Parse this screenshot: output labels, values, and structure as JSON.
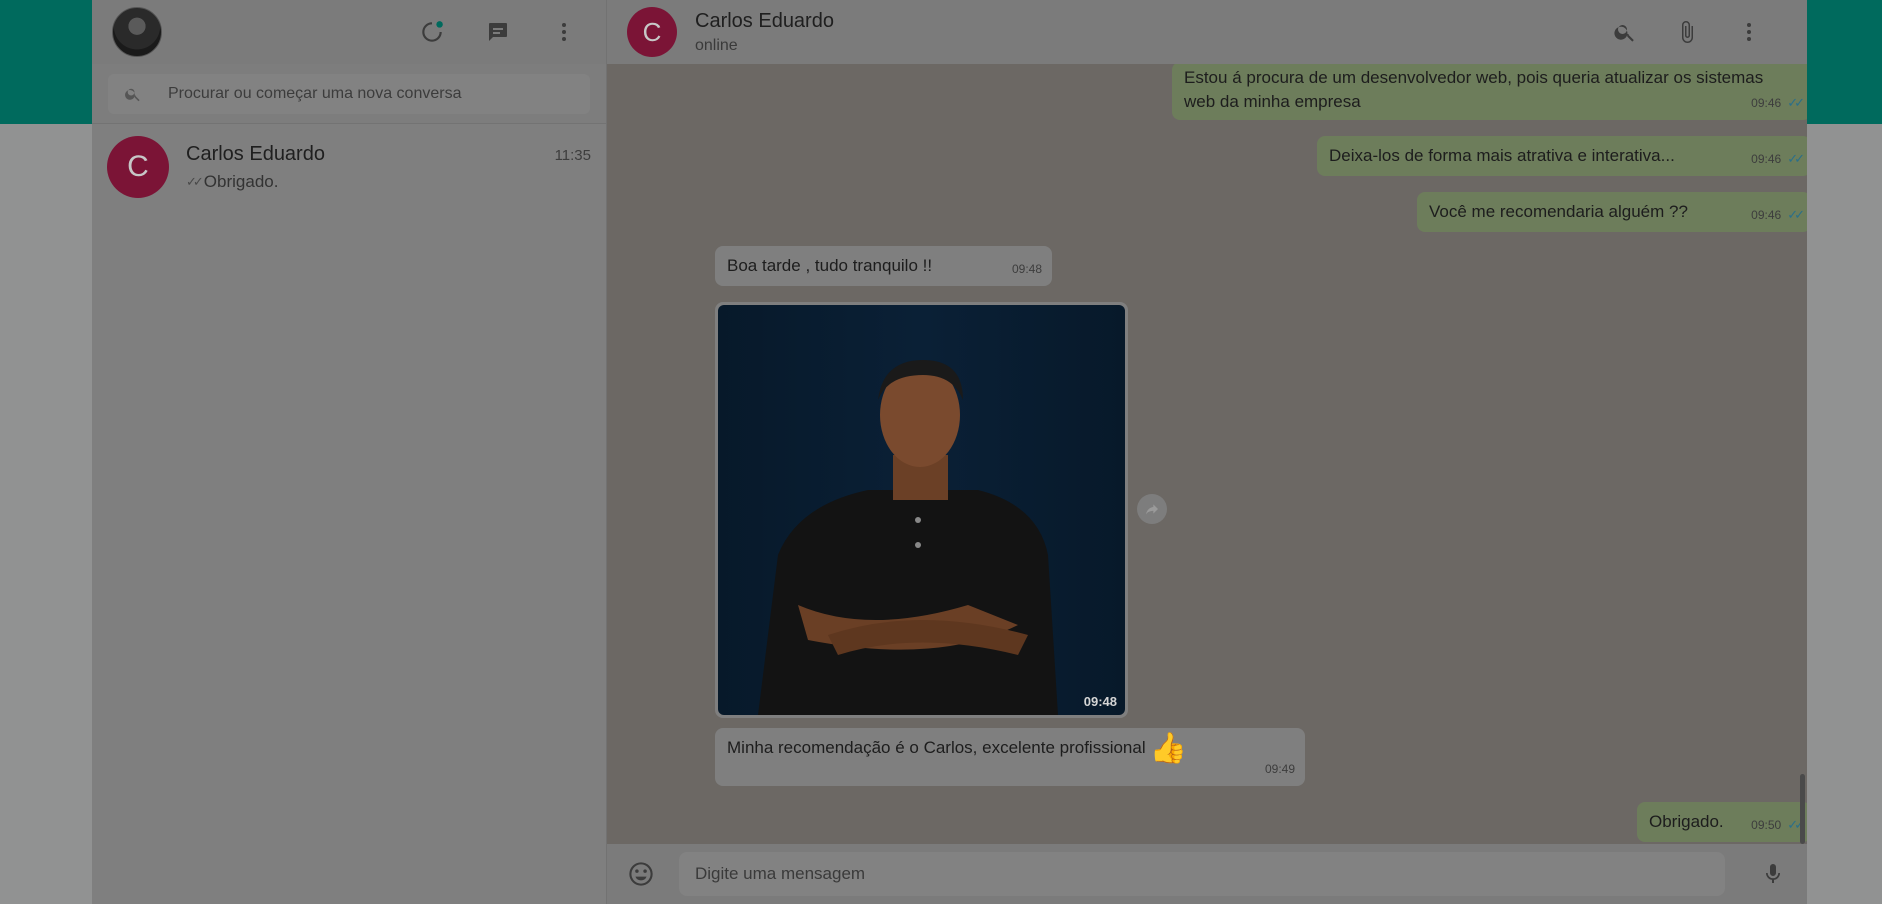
{
  "sidebar": {
    "icons": {
      "status": "status-icon",
      "new_chat": "new-chat-icon",
      "menu": "menu-dots-icon"
    },
    "search": {
      "placeholder": "Procurar ou começar uma nova conversa",
      "icon": "search-icon"
    },
    "chats": [
      {
        "initial": "C",
        "name": "Carlos Eduardo",
        "time": "11:35",
        "preview": "Obrigado.",
        "ticks": "✓✓"
      }
    ]
  },
  "conversation": {
    "contact": {
      "initial": "C",
      "name": "Carlos Eduardo",
      "status": "online"
    },
    "icons": {
      "search": "search-icon",
      "attach": "paperclip-icon",
      "menu": "menu-dots-icon"
    },
    "messages": [
      {
        "dir": "out",
        "text": "Estou á procura de um desenvolvedor web, pois queria atualizar os sistemas web da minha empresa",
        "time": "09:46",
        "ticks": "✓✓"
      },
      {
        "dir": "out",
        "text": "Deixa-los de forma mais atrativa e interativa...",
        "time": "09:46",
        "ticks": "✓✓"
      },
      {
        "dir": "out",
        "text": "Você me recomendaria alguém ??",
        "time": "09:46",
        "ticks": "✓✓"
      },
      {
        "dir": "in",
        "text": "Boa tarde , tudo tranquilo !!",
        "time": "09:48"
      },
      {
        "dir": "in",
        "type": "image",
        "time": "09:48"
      },
      {
        "dir": "in",
        "text": "Minha recomendação é o Carlos, excelente profissional",
        "emoji": "👍",
        "time": "09:49"
      },
      {
        "dir": "out",
        "text": "Obrigado.",
        "time": "09:50",
        "ticks": "✓✓"
      }
    ],
    "composer": {
      "placeholder": "Digite uma mensagem",
      "emoji_icon": "emoji-icon",
      "mic_icon": "mic-icon"
    }
  },
  "colors": {
    "brand_band": "#006a5d",
    "avatar": "#7b1436",
    "outgoing_bubble": "#6d7d5b",
    "read_ticks": "#2a6f8a"
  }
}
